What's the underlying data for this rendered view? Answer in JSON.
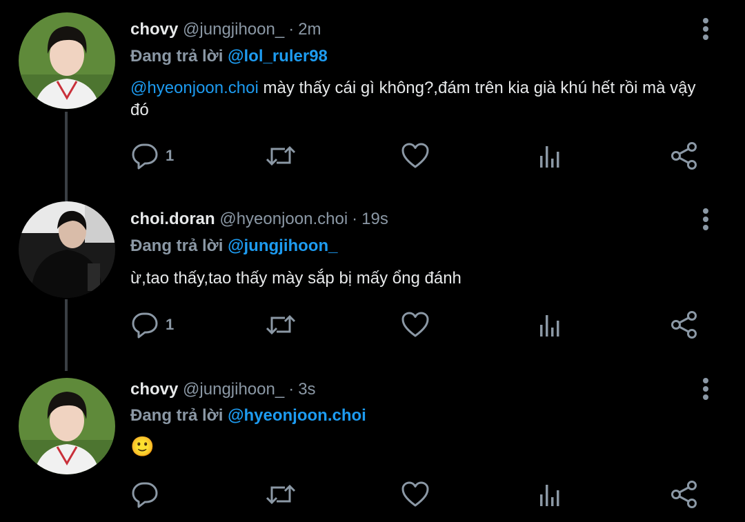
{
  "reply_prefix": "Đang trả lời",
  "colors": {
    "background": "#000000",
    "text_primary": "#e7e9ea",
    "text_secondary": "#8b98a5",
    "link": "#1d9bf0",
    "thread_line": "#3a3f44"
  },
  "icons": {
    "reply": "reply-icon",
    "retweet": "retweet-icon",
    "like": "heart-icon",
    "views": "views-icon",
    "share": "share-icon",
    "more": "more-vertical-icon"
  },
  "tweets": [
    {
      "name": "chovy",
      "handle": "@jungjihoon_",
      "separator": "·",
      "time": "2m",
      "reply_to": "@lol_ruler98",
      "mention": "@hyeonjoon.choi",
      "text": " mày thấy cái gì không?,đám trên kia già khú hết rồi mà vậy đó",
      "reply_count": "1"
    },
    {
      "name": "choi.doran",
      "handle": "@hyeonjoon.choi",
      "separator": "·",
      "time": "19s",
      "reply_to": "@jungjihoon_",
      "text": "ừ,tao thấy,tao thấy mày sắp bị mấy ổng đánh",
      "reply_count": "1"
    },
    {
      "name": "chovy",
      "handle": "@jungjihoon_",
      "separator": "·",
      "time": "3s",
      "reply_to": "@hyeonjoon.choi",
      "text": "🙂",
      "reply_count": ""
    }
  ]
}
